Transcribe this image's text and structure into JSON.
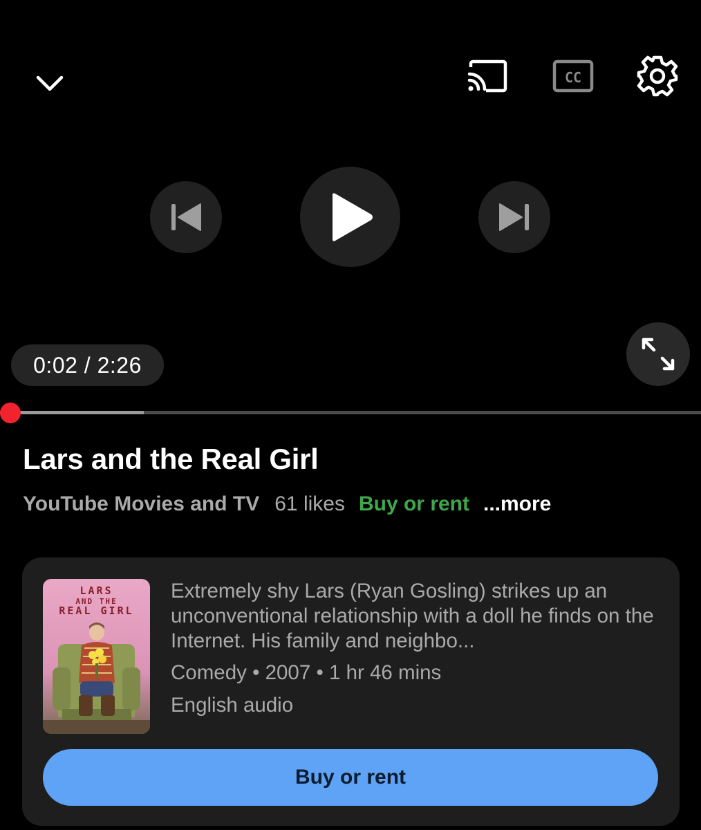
{
  "player": {
    "time_display": "0:02 / 2:26",
    "progress": {
      "played_fraction": 0.015,
      "buffered_fraction": 0.205
    },
    "accent_color": "#ff0033"
  },
  "icons": {
    "collapse": "chevron-down-icon",
    "cast": "cast-icon",
    "captions": "closed-captions-icon",
    "settings": "gear-icon",
    "previous": "skip-previous-icon",
    "play": "play-icon",
    "next": "skip-next-icon",
    "fullscreen": "fullscreen-icon"
  },
  "captions_label": "CC",
  "video": {
    "title": "Lars and the Real Girl",
    "channel": "YouTube Movies and TV",
    "likes": "61 likes",
    "buy_link": "Buy or rent",
    "more": "...more"
  },
  "movie_card": {
    "poster_title_lines": [
      "LARS",
      "AND THE",
      "REAL GIRL"
    ],
    "description": "Extremely shy Lars (Ryan Gosling) strikes up an unconventional relationship with a doll he finds on the Internet. His family and neighbo...",
    "genre": "Comedy",
    "year": "2007",
    "duration": "1 hr 46 mins",
    "audio": "English audio",
    "cta_label": "Buy or rent",
    "cta_color": "#5ea3f5"
  }
}
